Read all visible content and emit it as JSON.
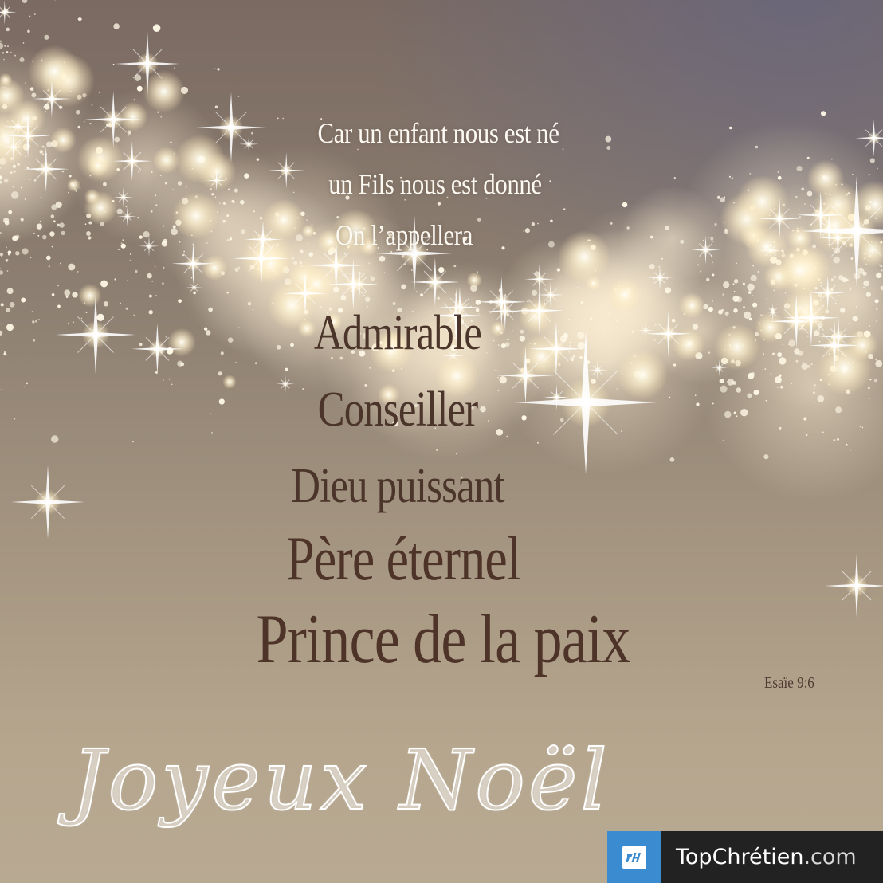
{
  "verse": {
    "lines": [
      "Car un enfant nous est né",
      "un Fils nous est donné",
      "On l’appellera",
      "Admirable",
      "Conseiller",
      "Dieu puissant",
      "Père éternel",
      "Prince de la paix"
    ],
    "reference": "Esaïe 9:6"
  },
  "greeting": "Joyeux Noël",
  "brand": {
    "logo_icon": "topchretien-logo-icon",
    "name": "TopChrétien",
    "tld": ".com",
    "color": "#3a8bcf"
  },
  "colors": {
    "verse_light": "#fdfaf4",
    "verse_dark": "#4b342a",
    "sparkle": "#fff6dc"
  }
}
